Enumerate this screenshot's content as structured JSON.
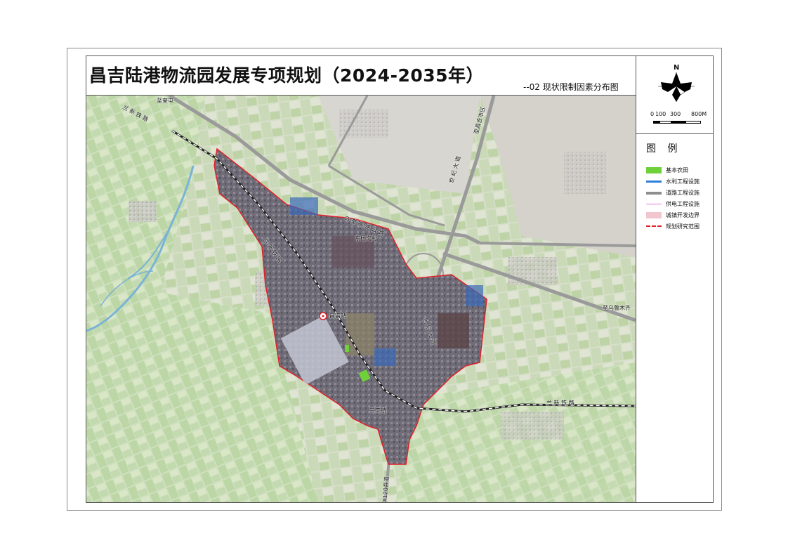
{
  "title": "昌吉陆港物流园发展专项规划（2024-2035年）",
  "subtitle": "--02 现状限制因素分布图",
  "north_label": "N",
  "scale": {
    "ticks": [
      "0",
      "100",
      "300",
      "800M"
    ]
  },
  "legend": {
    "title": "图 例",
    "items": [
      {
        "label": "基本农田",
        "color": "#6fd13a"
      },
      {
        "label": "水利工程设施",
        "color": "#2f7fd8"
      },
      {
        "label": "道路工程设施",
        "color": "#8e8e8e"
      },
      {
        "label": "供电工程设施",
        "color": "#e27be0"
      },
      {
        "label": "城镇开发边界",
        "color": "#f1c6cf"
      },
      {
        "label": "规划研究范围",
        "color": "#e0202a"
      }
    ]
  },
  "map_labels": {
    "road_top_left": "至奎屯",
    "railway_northwest": "兰 新 铁 路",
    "road_north": "至昌吉市区",
    "expressway": "乌 奎 高 速 公 路",
    "avenue_north": "世 纪 大 道",
    "village": "东杨沟村",
    "railway_center": "兰 新 铁 路",
    "station": "昌吉站",
    "road_east": "至乌鲁木齐",
    "avenue_center": "世 纪 大 道",
    "railway_east": "兰 新 铁 路",
    "town": "三工镇",
    "county_road": "X120县道"
  }
}
